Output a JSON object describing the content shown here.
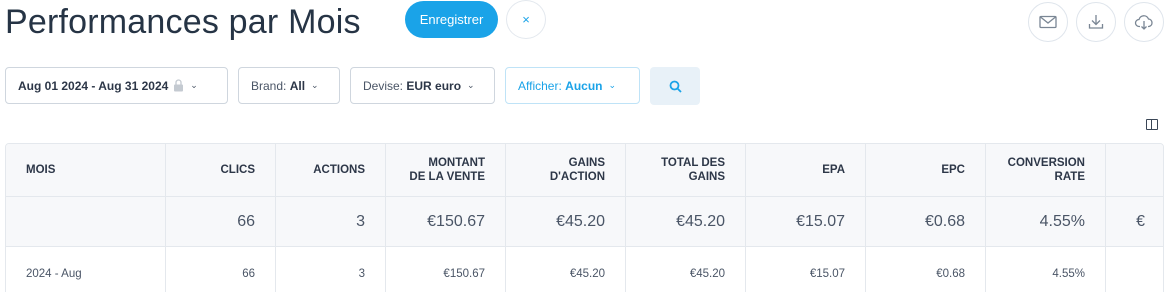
{
  "page_title": "Performances par Mois",
  "actions": {
    "save_label": "Enregistrer",
    "close_glyph": "×"
  },
  "toolbar_icons": [
    "mail-icon",
    "download-icon",
    "cloud-download-icon"
  ],
  "filters": {
    "date_range": "Aug 01 2024 - Aug 31 2024",
    "brand_label": "Brand:",
    "brand_value": "All",
    "currency_label": "Devise:",
    "currency_value": "EUR euro",
    "show_label": "Afficher:",
    "show_value": "Aucun"
  },
  "table": {
    "headers": [
      "MOIS",
      "CLICS",
      "ACTIONS",
      "MONTANT\nDE LA VENTE",
      "GAINS\nD'ACTION",
      "TOTAL DES\nGAINS",
      "EPA",
      "EPC",
      "CONVERSION\nRATE",
      ""
    ],
    "totals": [
      "",
      "66",
      "3",
      "€150.67",
      "€45.20",
      "€45.20",
      "€15.07",
      "€0.68",
      "4.55%",
      "€"
    ],
    "rows": [
      [
        "2024 - Aug",
        "66",
        "3",
        "€150.67",
        "€45.20",
        "€45.20",
        "€15.07",
        "€0.68",
        "4.55%",
        ""
      ]
    ]
  },
  "colors": {
    "accent": "#1aa3e8",
    "title": "#263445",
    "header_bg": "#f7f8fa"
  }
}
